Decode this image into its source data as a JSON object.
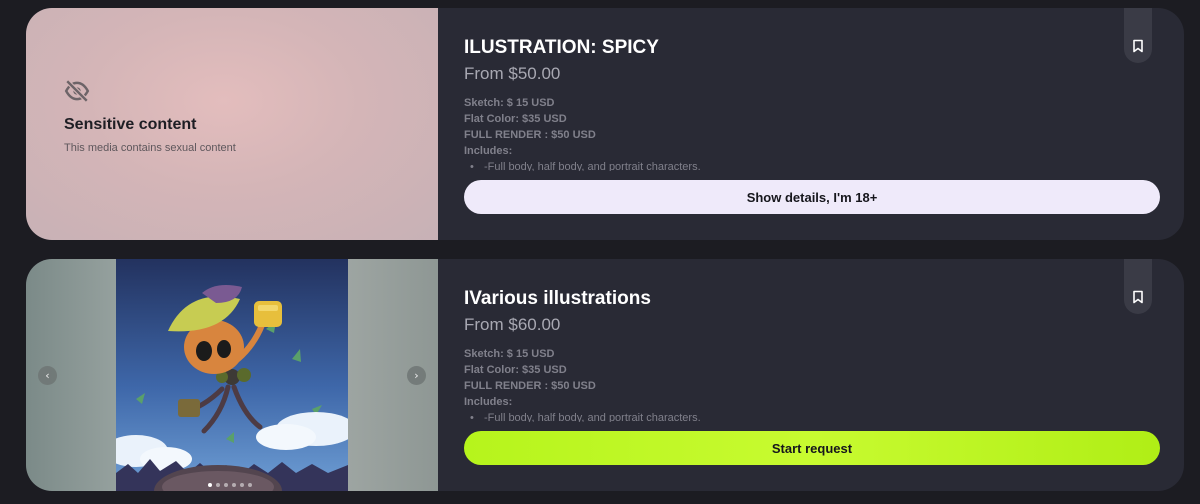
{
  "listings": [
    {
      "title": "ILUSTRATION: SPICY",
      "price": "From $50.00",
      "sensitive": {
        "icon": "eye-off-icon",
        "title": "Sensitive content",
        "subtitle": "This media contains sexual content"
      },
      "details": {
        "sketch": "Sketch: $ 15 USD",
        "flat_color": "Flat Color: $35 USD",
        "full_render": "FULL RENDER : $50 USD",
        "includes": "Includes:",
        "bullet": "-Full body, half body, and portrait characters."
      },
      "bookmark_icon": "bookmark-icon",
      "button_label": "Show details, I'm 18+"
    },
    {
      "title": "IVarious illustrations",
      "price": "From $60.00",
      "gallery": {
        "prev_icon": "chevron-left-icon",
        "next_icon": "chevron-right-icon",
        "slide_count": 6,
        "active_slide": 1
      },
      "details": {
        "sketch": "Sketch: $ 15 USD",
        "flat_color": "Flat Color: $35 USD",
        "full_render": "FULL RENDER : $50 USD",
        "includes": "Includes:",
        "bullet": "-Full body, half body, and portrait characters."
      },
      "bookmark_icon": "bookmark-icon",
      "button_label": "Start request"
    }
  ],
  "colors": {
    "background": "#1c1c22",
    "card": "#292a35",
    "accent_lime": "#c2f82a",
    "details_button": "#efeafa"
  }
}
